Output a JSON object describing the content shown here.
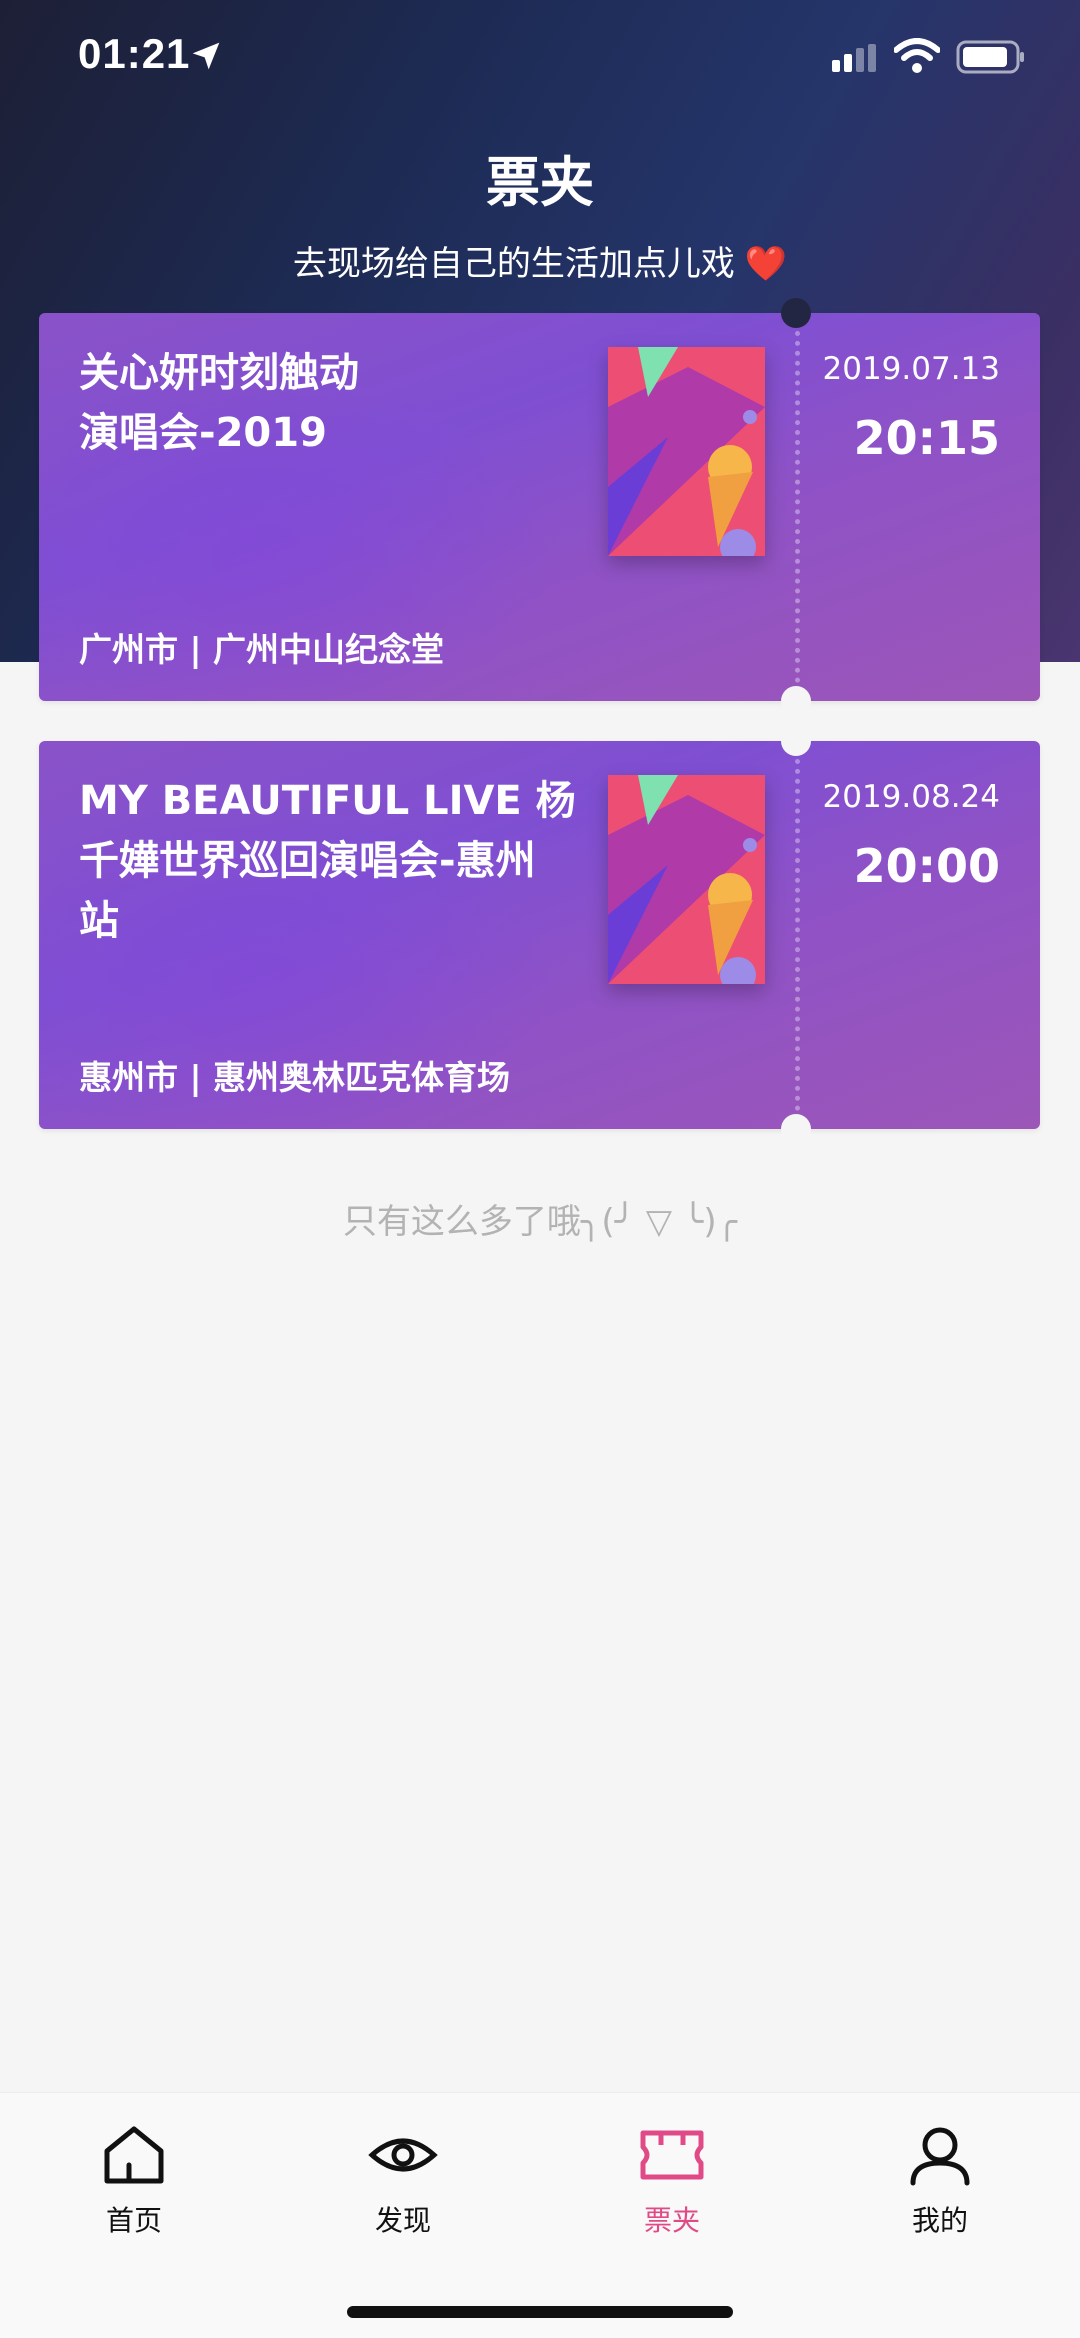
{
  "status_bar": {
    "time": "01:21"
  },
  "header": {
    "title": "票夹",
    "subtitle": "去现场给自己的生活加点儿戏",
    "subtitle_emoji": "❤️"
  },
  "tickets": [
    {
      "title_lines": [
        "关心妍时刻触动",
        "演唱会-2019"
      ],
      "venue": "广州市 | 广州中山纪念堂",
      "date": "2019.07.13",
      "time": "20:15"
    },
    {
      "title_lines": [
        "MY BEAUTIFUL LIVE 杨",
        "千嬅世界巡回演唱会-惠州",
        "站"
      ],
      "venue": "惠州市 | 惠州奥林匹克体育场",
      "date": "2019.08.24",
      "time": "20:00"
    }
  ],
  "list_end_text": "只有这么多了哦╮(╯ ▽ ╰)╭",
  "tabbar": {
    "items": [
      {
        "label": "首页",
        "icon": "home-icon",
        "active": false
      },
      {
        "label": "发现",
        "icon": "eye-icon",
        "active": false
      },
      {
        "label": "票夹",
        "icon": "ticket-icon",
        "active": true
      },
      {
        "label": "我的",
        "icon": "user-icon",
        "active": false
      }
    ]
  },
  "colors": {
    "accent": "#e04a86",
    "ticket_purple": "#8a52c8",
    "header_dark": "#1d2b55"
  }
}
